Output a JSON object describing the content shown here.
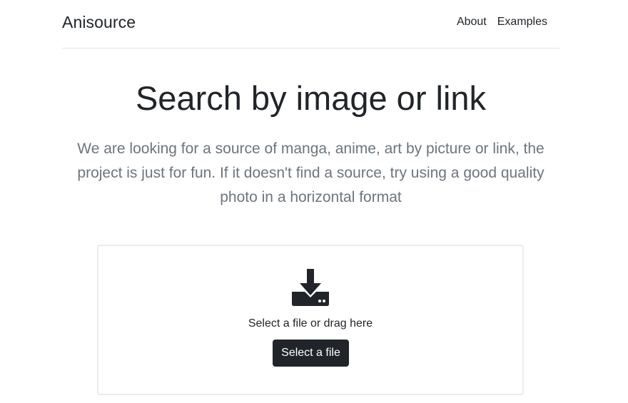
{
  "header": {
    "brand": "Anisource",
    "nav": [
      {
        "label": "About"
      },
      {
        "label": "Examples"
      }
    ]
  },
  "hero": {
    "title": "Search by image or link",
    "description": "We are looking for a source of manga, anime, art by picture or link, the project is just for fun. If it doesn't find a source, try using a good quality photo in a horizontal format"
  },
  "dropzone": {
    "icon": "download-icon",
    "prompt": "Select a file or drag here",
    "button_label": "Select a file"
  },
  "colors": {
    "primary_text": "#212529",
    "muted_text": "#6c757d",
    "button_bg": "#212529",
    "border": "#dee2e6"
  }
}
